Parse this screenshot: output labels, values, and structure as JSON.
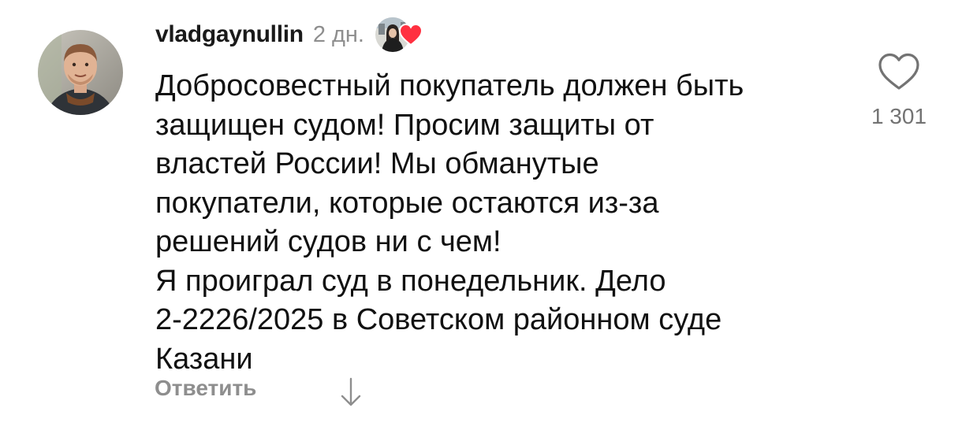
{
  "comment": {
    "username": "vladgaynullin",
    "time": "2 дн.",
    "text": "Добросовестный покупатель должен быть\nзащищен судом! Просим защиты от\nвластей России! Мы обманутые\nпокупатели, которые остаются из-за\nрешений судов ни с чем!\nЯ проиграл суд в понедельник. Дело\n2-2226/2025 в Советском районном суде\nКазани",
    "reply_label": "Ответить",
    "like_count": "1 301",
    "liked_by_author": true
  },
  "icons": {
    "like": "heart-outline-icon",
    "author_like_badge": "heart-filled-icon",
    "expand": "arrow-down-icon"
  },
  "colors": {
    "text": "#111111",
    "secondary": "#8e8e8e",
    "heart_red": "#ff3040"
  }
}
